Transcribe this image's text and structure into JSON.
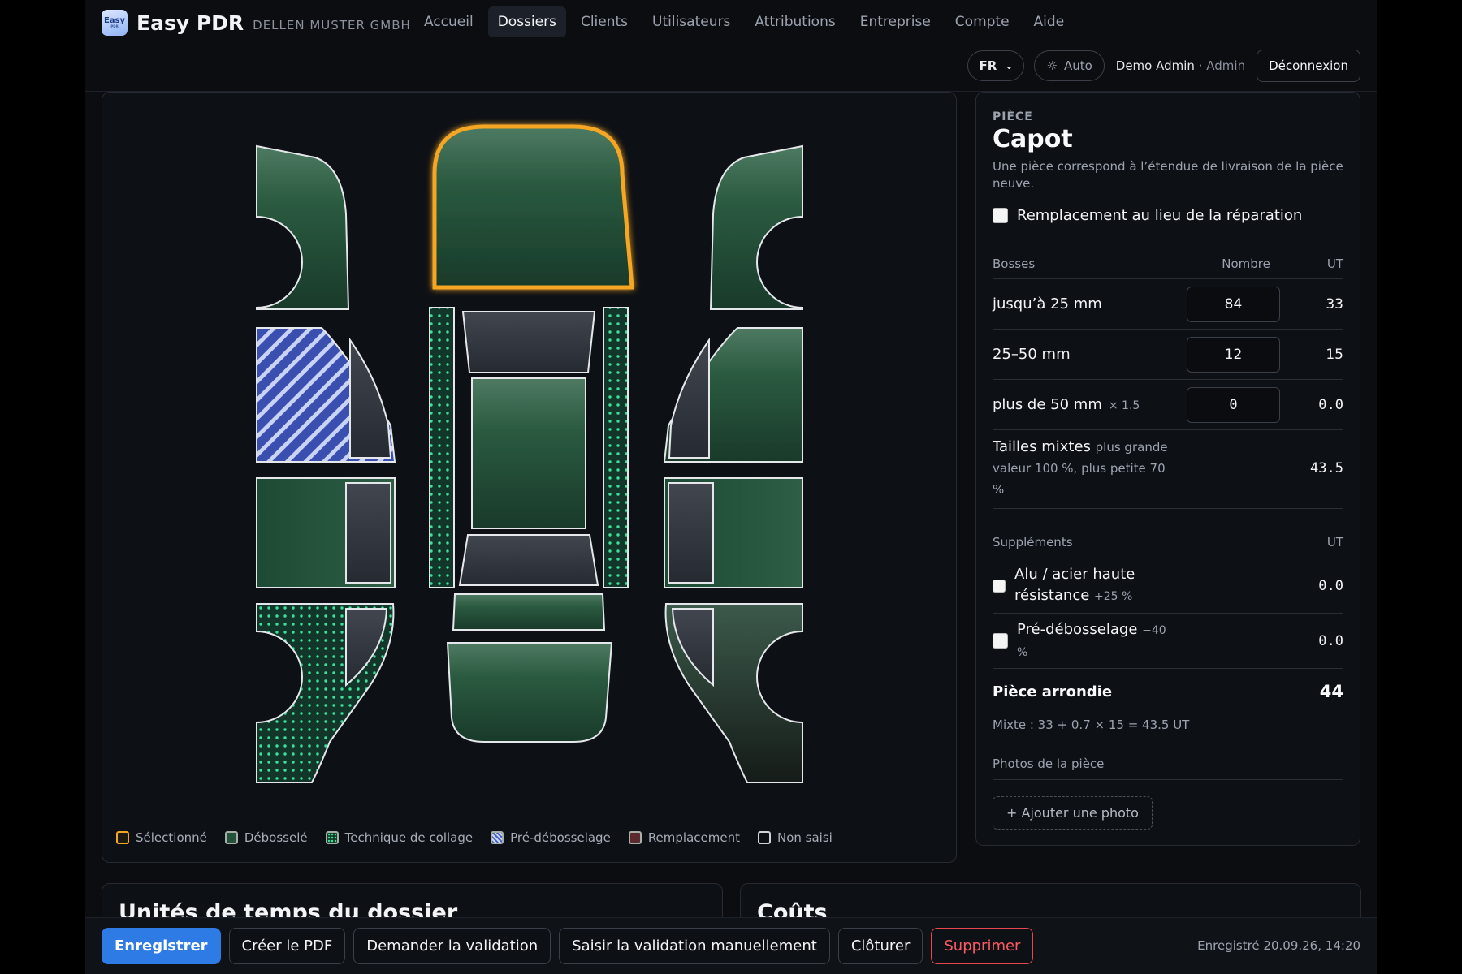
{
  "brand": {
    "logo_text": "Easy",
    "logo_sub": "PDR",
    "name": "Easy PDR",
    "company": "DELLEN MUSTER GMBH"
  },
  "nav": [
    {
      "label": "Accueil"
    },
    {
      "label": "Dossiers",
      "active": true
    },
    {
      "label": "Clients"
    },
    {
      "label": "Utilisateurs"
    },
    {
      "label": "Attributions"
    },
    {
      "label": "Entreprise"
    },
    {
      "label": "Compte"
    },
    {
      "label": "Aide"
    }
  ],
  "header": {
    "language": "FR",
    "theme": "Auto",
    "theme_icon": "sun-icon",
    "user_name": "Demo Admin",
    "user_sep": "·",
    "user_role": "Admin",
    "logout": "Déconnexion"
  },
  "legend": [
    {
      "label": "Sélectionné",
      "key": "sel"
    },
    {
      "label": "Débosselé",
      "key": "deb"
    },
    {
      "label": "Technique de collage",
      "key": "col"
    },
    {
      "label": "Pré-débosselage",
      "key": "pre"
    },
    {
      "label": "Remplacement",
      "key": "rep"
    },
    {
      "label": "Non saisi",
      "key": "non"
    }
  ],
  "colors": {
    "selected": "#f5a623",
    "debosselé": "#2a5a40",
    "collage": "#3fe09a",
    "pre": "#4a63c9",
    "primary": "#2f7be6",
    "danger": "#e5484d"
  },
  "piece": {
    "eyebrow": "PIÈCE",
    "title": "Capot",
    "description": "Une pièce correspond à l’étendue de livraison de la pièce neuve.",
    "replace_label": "Remplacement au lieu de la réparation",
    "table": {
      "col_label": "Bosses",
      "col_count": "Nombre",
      "col_ut": "UT",
      "rows": [
        {
          "label": "jusqu’à 25 mm",
          "mult": "",
          "count": "84",
          "ut": "33"
        },
        {
          "label": "25–50 mm",
          "mult": "",
          "count": "12",
          "ut": "15"
        },
        {
          "label": "plus de 50 mm",
          "mult": "× 1.5",
          "count": "0",
          "ut": "0.0"
        }
      ],
      "mixed_label": "Tailles mixtes",
      "mixed_note": "plus grande valeur 100 %, plus petite 70 %",
      "mixed_ut": "43.5"
    },
    "supplements": {
      "col_label": "Suppléments",
      "col_ut": "UT",
      "rows": [
        {
          "label": "Alu / acier haute résistance",
          "note": "+25 %",
          "ut": "0.0"
        },
        {
          "label": "Pré-débosselage",
          "note": "−40 %",
          "ut": "0.0"
        }
      ]
    },
    "total_label": "Pièce arrondie",
    "total_value": "44",
    "formula": "Mixte : 33 + 0.7 × 15 = 43.5 UT",
    "photos_label": "Photos de la pièce",
    "add_photo": "+ Ajouter une photo"
  },
  "cards": {
    "time_units": "Unités de temps du dossier",
    "costs": "Coûts"
  },
  "actions": {
    "save": "Enregistrer",
    "pdf": "Créer le PDF",
    "request": "Demander la validation",
    "manual": "Saisir la validation manuellement",
    "close": "Clôturer",
    "delete": "Supprimer",
    "saved": "Enregistré 20.09.26, 14:20"
  }
}
